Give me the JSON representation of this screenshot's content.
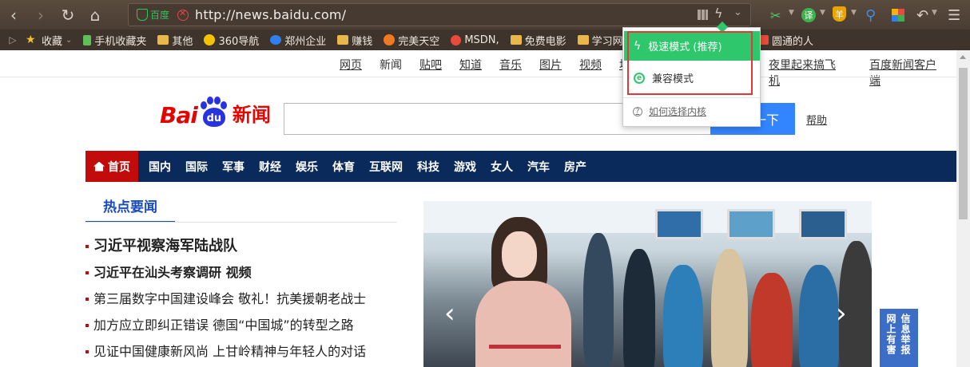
{
  "browser": {
    "nav": {
      "back": "‹",
      "forward": "›",
      "reload": "↻",
      "home": "⌂"
    },
    "address": {
      "site_badge": "百度",
      "url": "http://news.baidu.com/"
    },
    "bookmarks": [
      {
        "label": "收藏",
        "icon": "star-icon"
      },
      {
        "label": "手机收藏夹",
        "icon": "phone-icon"
      },
      {
        "label": "其他",
        "icon": "folder-icon"
      },
      {
        "label": "360导航",
        "icon": "360-icon"
      },
      {
        "label": "郑州企业",
        "icon": "ie-icon"
      },
      {
        "label": "赚钱",
        "icon": "folder-icon"
      },
      {
        "label": "完美天空",
        "icon": "fire-icon"
      },
      {
        "label": "MSDN,",
        "icon": "msdn-icon"
      },
      {
        "label": "免费电影",
        "icon": "folder-icon"
      },
      {
        "label": "学习网站",
        "icon": "folder-icon"
      },
      {
        "label": "圆通的人",
        "icon": "pdf-icon"
      }
    ],
    "toolbar_icons": {
      "translate": "译",
      "shield": "羊"
    }
  },
  "kernel_popup": {
    "fast_mode": "极速模式 (推荐)",
    "compat_mode": "兼容模式",
    "help": "如何选择内核",
    "accent": "#2fc76b",
    "highlight_color": "#e53535"
  },
  "page": {
    "topnav": [
      "网页",
      "新闻",
      "贴吧",
      "知道",
      "音乐",
      "图片",
      "视频",
      "地"
    ],
    "topnav_right": [
      "夜里起来搞飞机",
      "百度新闻客户端"
    ],
    "logo": {
      "bai": "Bai",
      "du": "du",
      "news": "新闻"
    },
    "search": {
      "button": "一下",
      "help": "帮助"
    },
    "channels": {
      "home": "首页",
      "items": [
        "国内",
        "国际",
        "军事",
        "财经",
        "娱乐",
        "体育",
        "互联网",
        "科技",
        "游戏",
        "女人",
        "汽车",
        "房产"
      ]
    },
    "hot": {
      "title": "热点要闻",
      "headlines": [
        "习近平视察海军陆战队",
        "习近平在汕头考察调研  视频",
        "第三届数字中国建设峰会 敬礼！抗美援朝老战士",
        "加方应立即纠正错误  德国“中国城”的转型之路",
        "见证中国健康新风尚 上甘岭精神与年轻人的对话"
      ]
    },
    "report": {
      "col1": "网上有害",
      "col2": "信息举报"
    },
    "colors": {
      "channel_bar": "#0b2a5c",
      "home_tab": "#c20c0c",
      "hot_title": "#1a4dbb",
      "search_button": "#3385ff"
    }
  }
}
